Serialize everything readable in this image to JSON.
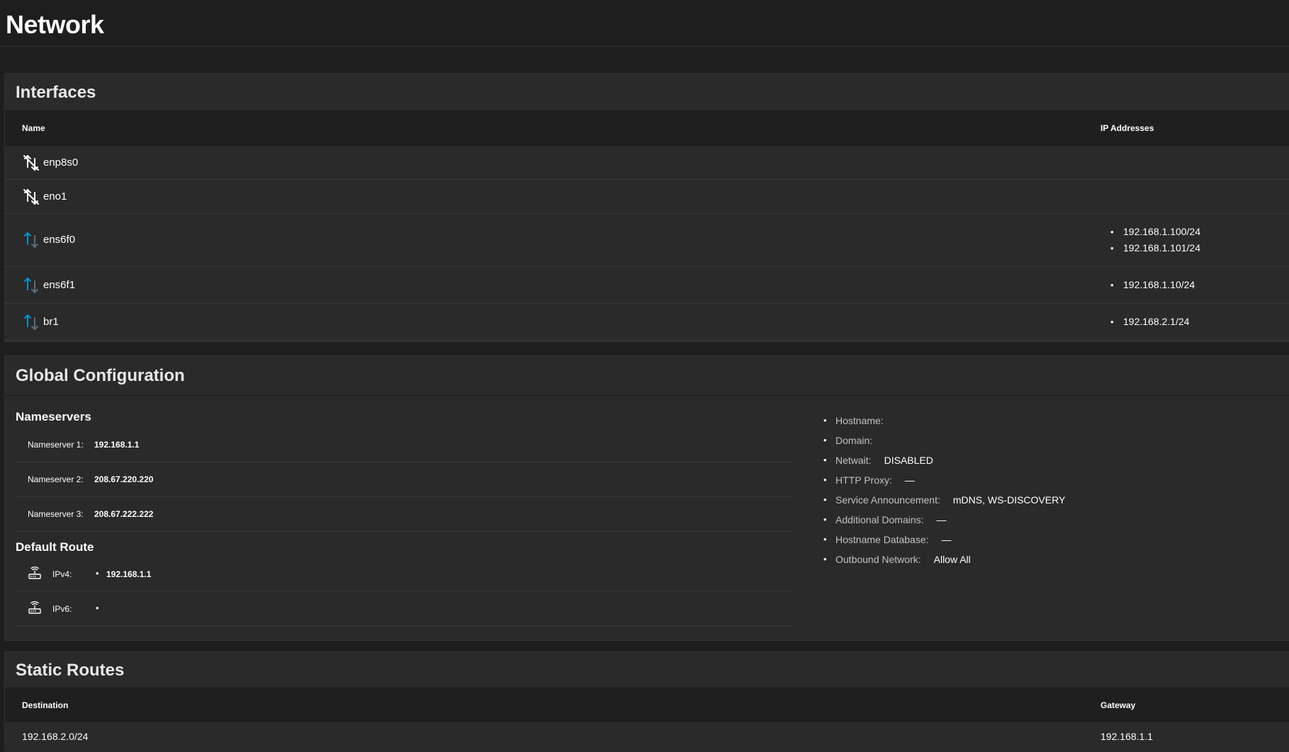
{
  "page": {
    "title": "Network"
  },
  "interfaces": {
    "title": "Interfaces",
    "columns": {
      "name": "Name",
      "ip_addresses": "IP Addresses"
    },
    "rows": [
      {
        "name": "enp8s0",
        "status": "link-down",
        "ips": []
      },
      {
        "name": "eno1",
        "status": "link-down",
        "ips": []
      },
      {
        "name": "ens6f0",
        "status": "link-up",
        "ips": [
          "192.168.1.100/24",
          "192.168.1.101/24"
        ]
      },
      {
        "name": "ens6f1",
        "status": "link-up",
        "ips": [
          "192.168.1.10/24"
        ]
      },
      {
        "name": "br1",
        "status": "link-up",
        "ips": [
          "192.168.2.1/24"
        ]
      }
    ]
  },
  "global_config": {
    "title": "Global Configuration",
    "nameservers": {
      "title": "Nameservers",
      "items": [
        {
          "label": "Nameserver 1:",
          "value": "192.168.1.1"
        },
        {
          "label": "Nameserver 2:",
          "value": "208.67.220.220"
        },
        {
          "label": "Nameserver 3:",
          "value": "208.67.222.222"
        }
      ]
    },
    "default_route": {
      "title": "Default Route",
      "ipv4": {
        "label": "IPv4:",
        "value": "192.168.1.1"
      },
      "ipv6": {
        "label": "IPv6:",
        "value": ""
      }
    },
    "settings": [
      {
        "label": "Hostname:",
        "value": ""
      },
      {
        "label": "Domain:",
        "value": ""
      },
      {
        "label": "Netwait:",
        "value": "DISABLED"
      },
      {
        "label": "HTTP Proxy:",
        "value": "—"
      },
      {
        "label": "Service Announcement:",
        "value": "mDNS, WS-DISCOVERY"
      },
      {
        "label": "Additional Domains:",
        "value": "—"
      },
      {
        "label": "Hostname Database:",
        "value": "—"
      },
      {
        "label": "Outbound Network:",
        "value": "Allow All"
      }
    ]
  },
  "static_routes": {
    "title": "Static Routes",
    "columns": {
      "destination": "Destination",
      "gateway": "Gateway"
    },
    "rows": [
      {
        "destination": "192.168.2.0/24",
        "gateway": "192.168.1.1"
      }
    ]
  },
  "colors": {
    "background": "#1e1e1e",
    "card": "#2a2a2a",
    "table_header": "#1f1f1f",
    "link_down_icon": "#ffffff",
    "link_up_icon_up": "#0095d5",
    "link_up_icon_down": "#5e6e7a"
  },
  "icons": {
    "link_down": "network-off-icon",
    "link_up": "network-activity-icon",
    "router": "router-icon"
  }
}
